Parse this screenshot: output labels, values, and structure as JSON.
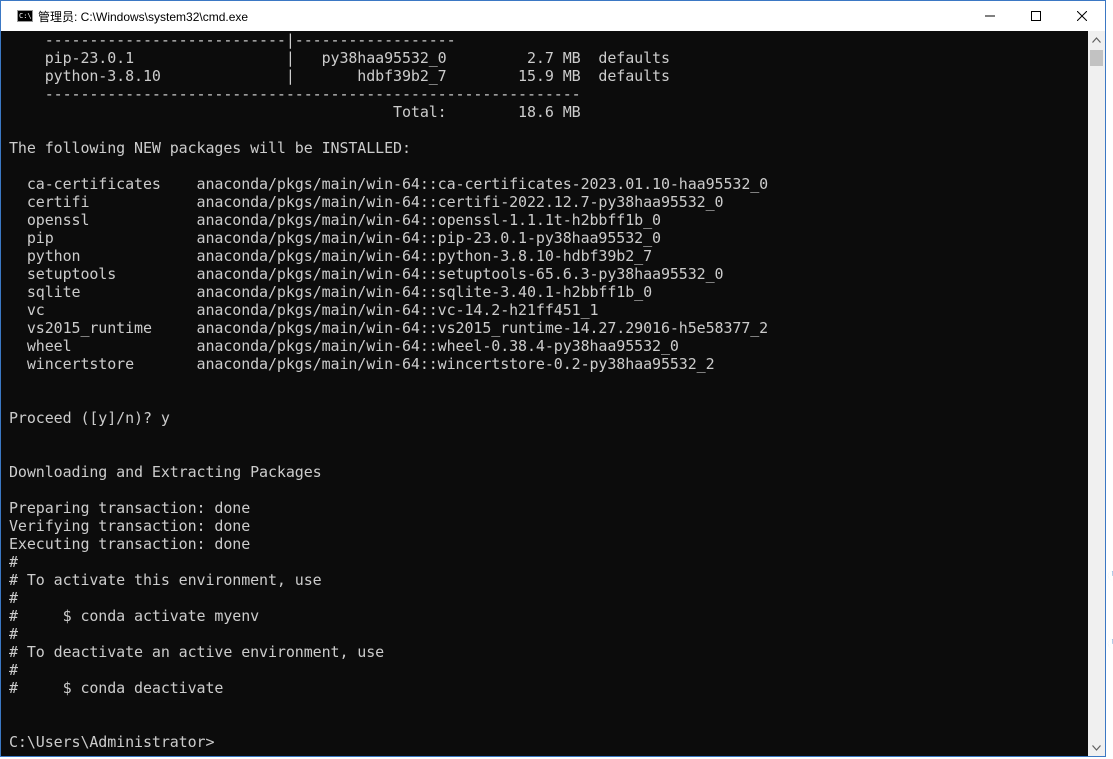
{
  "window": {
    "title": "管理员: C:\\Windows\\system32\\cmd.exe",
    "icon_text": "C:\\"
  },
  "controls": {
    "minimize": "minimize-icon",
    "maximize": "maximize-icon",
    "close": "close-icon"
  },
  "console": {
    "lines": [
      "    ---------------------------|------------------",
      "    pip-23.0.1                 |   py38haa95532_0         2.7 MB  defaults",
      "    python-3.8.10              |       hdbf39b2_7        15.9 MB  defaults",
      "    ------------------------------------------------------------",
      "                                           Total:        18.6 MB",
      "",
      "The following NEW packages will be INSTALLED:",
      "",
      "  ca-certificates    anaconda/pkgs/main/win-64::ca-certificates-2023.01.10-haa95532_0",
      "  certifi            anaconda/pkgs/main/win-64::certifi-2022.12.7-py38haa95532_0",
      "  openssl            anaconda/pkgs/main/win-64::openssl-1.1.1t-h2bbff1b_0",
      "  pip                anaconda/pkgs/main/win-64::pip-23.0.1-py38haa95532_0",
      "  python             anaconda/pkgs/main/win-64::python-3.8.10-hdbf39b2_7",
      "  setuptools         anaconda/pkgs/main/win-64::setuptools-65.6.3-py38haa95532_0",
      "  sqlite             anaconda/pkgs/main/win-64::sqlite-3.40.1-h2bbff1b_0",
      "  vc                 anaconda/pkgs/main/win-64::vc-14.2-h21ff451_1",
      "  vs2015_runtime     anaconda/pkgs/main/win-64::vs2015_runtime-14.27.29016-h5e58377_2",
      "  wheel              anaconda/pkgs/main/win-64::wheel-0.38.4-py38haa95532_0",
      "  wincertstore       anaconda/pkgs/main/win-64::wincertstore-0.2-py38haa95532_2",
      "",
      "",
      "Proceed ([y]/n)? y",
      "",
      "",
      "Downloading and Extracting Packages",
      "",
      "Preparing transaction: done",
      "Verifying transaction: done",
      "Executing transaction: done",
      "#",
      "# To activate this environment, use",
      "#",
      "#     $ conda activate myenv",
      "#",
      "# To deactivate an active environment, use",
      "#",
      "#     $ conda deactivate",
      "",
      "",
      "C:\\Users\\Administrator>"
    ]
  },
  "colors": {
    "console_bg": "#0c0c0c",
    "console_text": "#cccccc",
    "window_border": "#3b78c4"
  }
}
